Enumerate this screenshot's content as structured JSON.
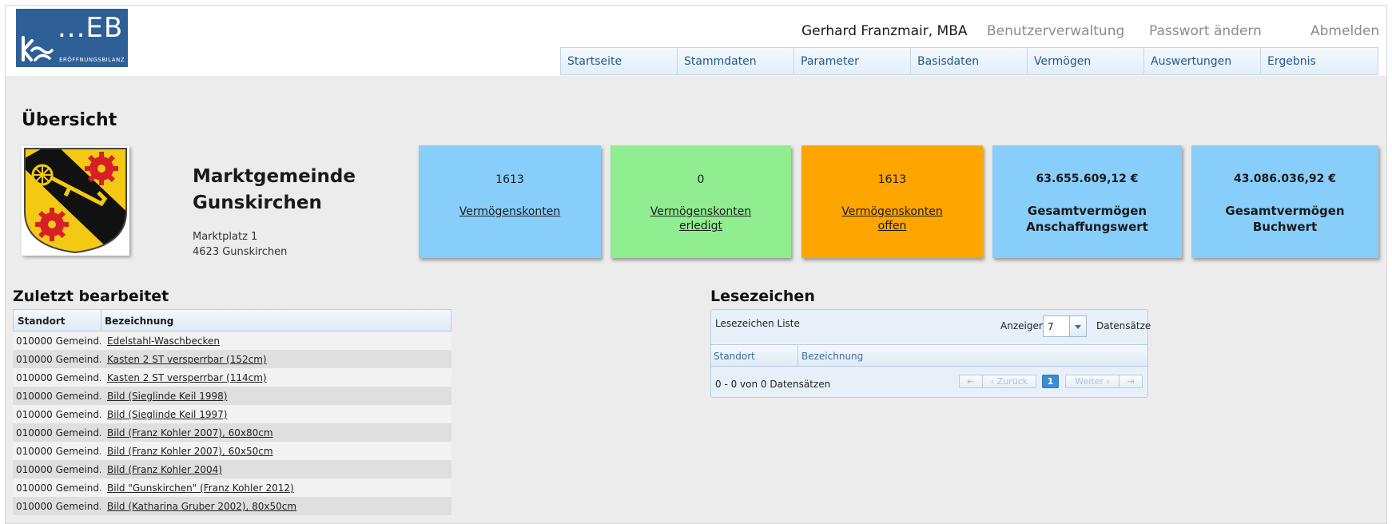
{
  "logo": {
    "text": "...EB",
    "subtitle": "ERÖFFNUNGSBILANZ"
  },
  "topnav": {
    "user": "Gerhard Franzmair, MBA",
    "links": [
      "Benutzerverwaltung",
      "Passwort ändern",
      "Abmelden"
    ]
  },
  "menu": [
    "Startseite",
    "Stammdaten",
    "Parameter",
    "Basisdaten",
    "Vermögen",
    "Auswertungen",
    "Ergebnis"
  ],
  "overview_title": "Übersicht",
  "municipality": {
    "name_line1": "Marktgemeinde",
    "name_line2": "Gunskirchen",
    "street": "Marktplatz 1",
    "city": "4623 Gunskirchen"
  },
  "stats": [
    {
      "value": "1613",
      "label_line1": "Vermögenskonten",
      "label_line2": "",
      "color": "#87cefa"
    },
    {
      "value": "0",
      "label_line1": "Vermögenskonten",
      "label_line2": "erledigt",
      "color": "#90ee90"
    },
    {
      "value": "1613",
      "label_line1": "Vermögenskonten",
      "label_line2": "offen",
      "color": "#ffa500"
    },
    {
      "value": "63.655.609,12 €",
      "label_line1": "Gesamtvermögen",
      "label_line2": "Anschaffungswert",
      "color": "#87cefa"
    },
    {
      "value": "43.086.036,92 €",
      "label_line1": "Gesamtvermögen",
      "label_line2": "Buchwert",
      "color": "#87cefa"
    }
  ],
  "recent": {
    "title": "Zuletzt bearbeitet",
    "columns": [
      "Standort",
      "Bezeichnung"
    ],
    "rows": [
      [
        "010000 Gemeind...",
        "Edelstahl-Waschbecken"
      ],
      [
        "010000 Gemeind...",
        "Kasten 2 ST versperrbar (152cm)"
      ],
      [
        "010000 Gemeind...",
        "Kasten 2 ST versperrbar (114cm)"
      ],
      [
        "010000 Gemeind...",
        "Bild (Sieglinde Keil 1998)"
      ],
      [
        "010000 Gemeind...",
        "Bild (Sieglinde Keil 1997)"
      ],
      [
        "010000 Gemeind...",
        "Bild (Franz Kohler 2007), 60x80cm"
      ],
      [
        "010000 Gemeind...",
        "Bild (Franz Kohler 2007), 60x50cm"
      ],
      [
        "010000 Gemeind...",
        "Bild (Franz Kohler 2004)"
      ],
      [
        "010000 Gemeind...",
        "Bild \"Gunskirchen\" (Franz Kohler 2012)"
      ],
      [
        "010000 Gemeind...",
        "Bild (Katharina Gruber 2002), 80x50cm"
      ]
    ]
  },
  "bookmarks": {
    "title": "Lesezeichen",
    "list_label": "Lesezeichen Liste",
    "show_label": "Anzeigen",
    "show_value": "7",
    "records_label": "Datensätze",
    "columns": [
      "Standort",
      "Bezeichnung"
    ],
    "status": "0 - 0 von 0 Datensätzen",
    "pager": {
      "first": "⇤",
      "prev": "‹ Zurück",
      "page": "1",
      "next": "Weiter ›",
      "last": "⇥"
    }
  }
}
